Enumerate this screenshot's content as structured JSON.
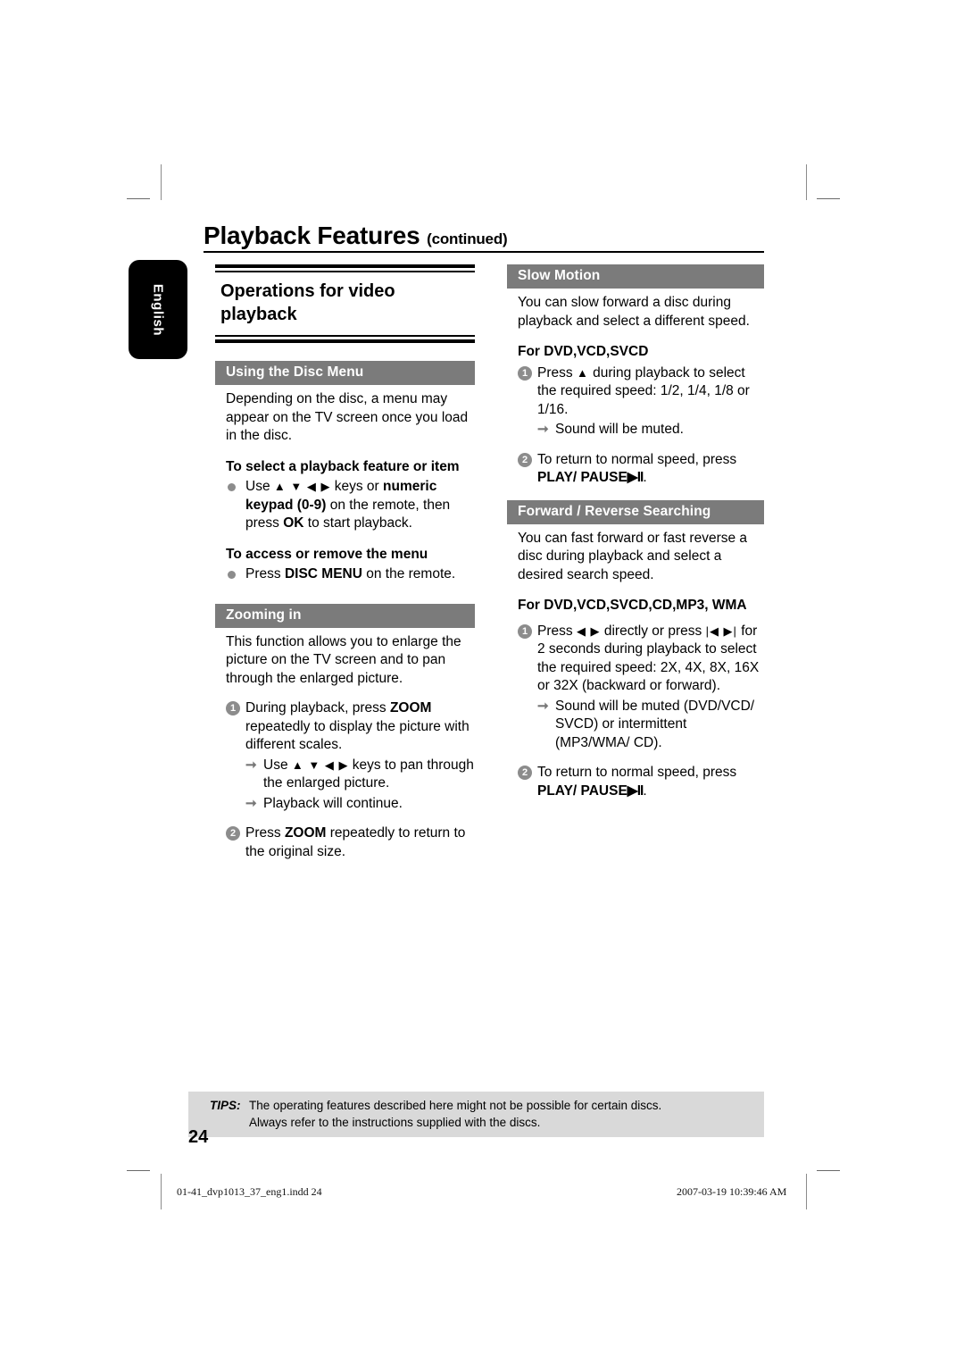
{
  "header": {
    "title_main": "Playback Features",
    "title_continued": "(continued)"
  },
  "language_tab": {
    "label": "English"
  },
  "left_column": {
    "section_heading": "Operations for video playback",
    "disc_menu": {
      "bar_label": "Using the Disc Menu",
      "intro": "Depending on the disc, a menu may appear on the TV screen once you load in the disc.",
      "subhead_1": "To select a playback feature or item",
      "bullet_1_pre": "Use ",
      "bullet_1_keys": "▲ ▼ ◀ ▶",
      "bullet_1_mid": " keys or ",
      "bullet_1_bold_a": "numeric keypad (0-9)",
      "bullet_1_mid2": " on the remote, then press ",
      "bullet_1_bold_b": "OK",
      "bullet_1_end": " to start playback.",
      "subhead_2": "To access or remove the menu",
      "bullet_2_pre": "Press ",
      "bullet_2_bold": "DISC MENU",
      "bullet_2_end": " on the remote."
    },
    "zooming": {
      "bar_label": "Zooming in",
      "intro": "This function allows you to enlarge the picture on the TV screen and to pan through the enlarged picture.",
      "step_1_num": "1",
      "step_1_pre": "During playback, press ",
      "step_1_bold": "ZOOM",
      "step_1_end": " repeatedly to display the picture with different scales.",
      "arrow_1_pre": "Use ",
      "arrow_1_keys": "▲ ▼ ◀ ▶",
      "arrow_1_end": " keys to pan through the enlarged picture.",
      "arrow_2": "Playback will continue.",
      "step_2_num": "2",
      "step_2_pre": "Press ",
      "step_2_bold": "ZOOM",
      "step_2_end": " repeatedly to return to the original size."
    }
  },
  "right_column": {
    "slow_motion": {
      "bar_label": "Slow Motion",
      "intro": "You can slow forward a disc during playback and select a different speed.",
      "subhead": "For DVD,VCD,SVCD",
      "step_1_num": "1",
      "step_1_pre": "Press ",
      "step_1_key": "▲",
      "step_1_end": " during playback to select the required speed: 1/2, 1/4, 1/8 or 1/16.",
      "arrow_1": "Sound will be muted.",
      "step_2_num": "2",
      "step_2_pre": "To return to normal speed, press ",
      "step_2_bold_a": "PLAY/ PAUSE",
      "step_2_glyph": "▶II",
      "step_2_end": "."
    },
    "searching": {
      "bar_label": "Forward / Reverse Searching",
      "intro": "You can fast forward or fast reverse a disc during playback and select a desired search speed.",
      "subhead": "For DVD,VCD,SVCD,CD,MP3, WMA",
      "step_1_num": "1",
      "step_1_pre": "Press ",
      "step_1_keys_a": "◀ ▶",
      "step_1_mid": " directly or press ",
      "step_1_keys_b": "|◀  ▶|",
      "step_1_end": " for 2 seconds during playback to select the required speed: 2X, 4X, 8X, 16X or 32X (backward or forward).",
      "arrow_1": "Sound will be muted (DVD/VCD/ SVCD) or intermittent (MP3/WMA/ CD).",
      "step_2_num": "2",
      "step_2_pre": "To return to normal speed, press ",
      "step_2_bold_a": "PLAY/ PAUSE",
      "step_2_glyph": "▶II",
      "step_2_end": "."
    }
  },
  "footer": {
    "tips_label": "TIPS:",
    "tips_line_1": "The operating features described here might not be possible for certain discs.",
    "tips_line_2": "Always refer to the instructions supplied with the discs.",
    "page_number": "24",
    "slug_file": "01-41_dvp1013_37_eng1.indd   24",
    "slug_date": "2007-03-19   10:39:46 AM"
  },
  "colors": {
    "bar_gray": "#7b7b7b",
    "marker_gray": "#8c8c8c",
    "tips_gray": "#d9d9d9",
    "tab_black": "#000000"
  }
}
